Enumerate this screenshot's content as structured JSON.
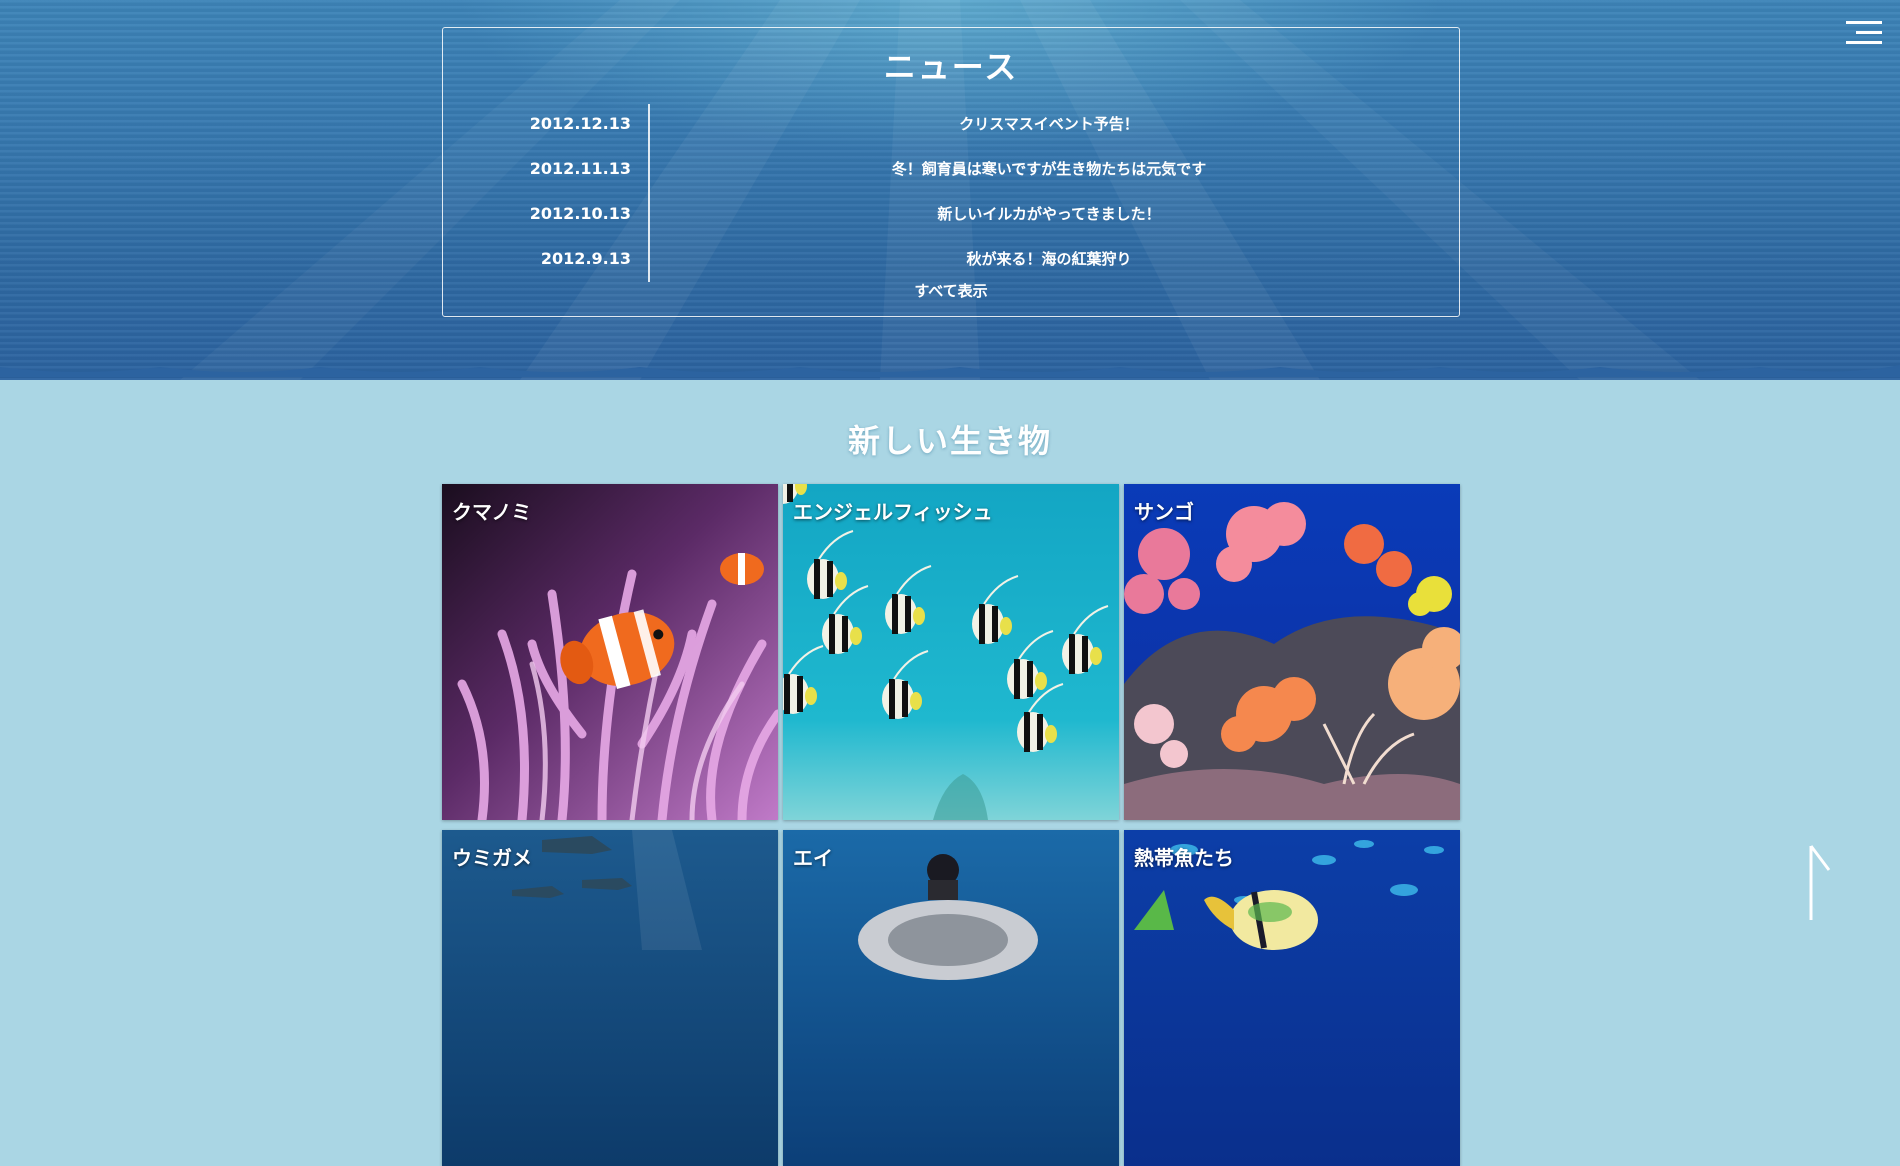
{
  "news": {
    "title": "ニュース",
    "items": [
      {
        "date": "2012.12.13",
        "text": "クリスマスイベント予告！"
      },
      {
        "date": "2012.11.13",
        "text": "冬！飼育員は寒いですが生き物たちは元気です"
      },
      {
        "date": "2012.10.13",
        "text": "新しいイルカがやってきました！"
      },
      {
        "date": "2012.9.13",
        "text": "秋が来る！海の紅葉狩り"
      }
    ],
    "view_all": "すべて表示"
  },
  "creatures": {
    "title": "新しい生き物",
    "cards": [
      {
        "label": "クマノミ"
      },
      {
        "label": "エンジェルフィッシュ"
      },
      {
        "label": "サンゴ"
      },
      {
        "label": "ウミガメ"
      },
      {
        "label": "エイ"
      },
      {
        "label": "熱帯魚たち"
      }
    ]
  },
  "icons": {
    "menu": "hamburger-menu-icon",
    "back_to_top": "up-arrow-icon"
  },
  "colors": {
    "page_background": "#aad6e4",
    "hero_blue": "#3779b0",
    "text": "#ffffff"
  }
}
